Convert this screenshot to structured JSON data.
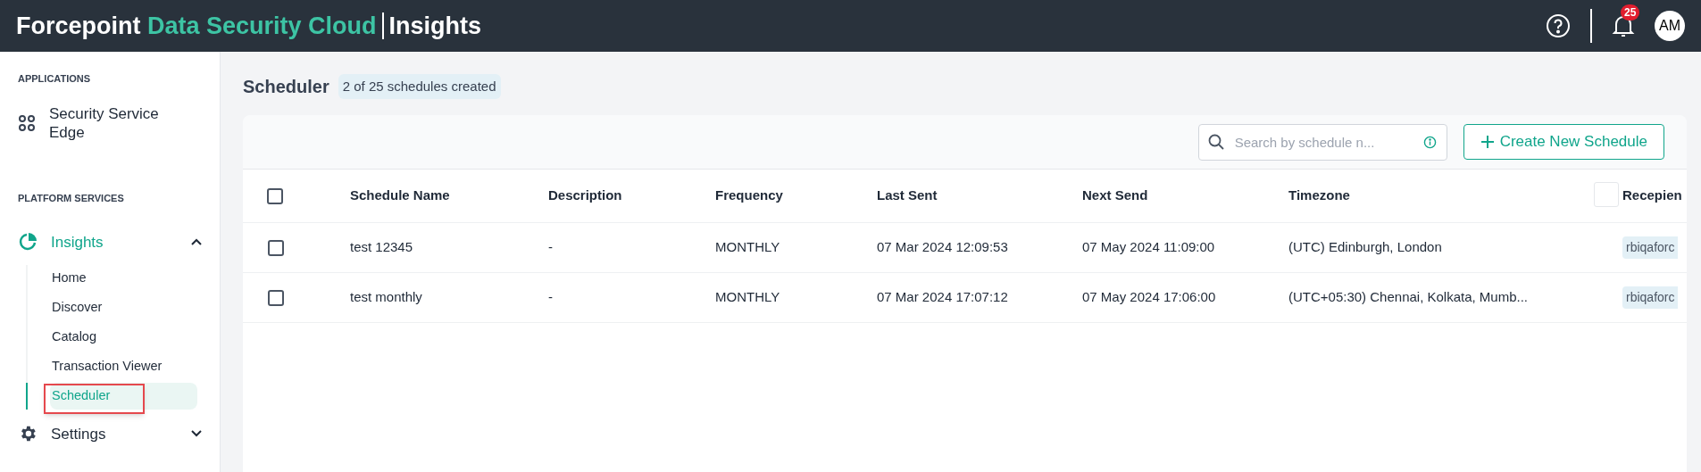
{
  "header": {
    "brand": "Forcepoint",
    "product": "Data Security Cloud",
    "module": "Insights",
    "notification_count": "25",
    "avatar": "AM"
  },
  "sidebar": {
    "sections": [
      {
        "heading": "APPLICATIONS",
        "items": [
          {
            "label": "Security Service Edge",
            "kind": "apps"
          }
        ]
      },
      {
        "heading": "PLATFORM SERVICES",
        "items": [
          {
            "label": "Insights",
            "kind": "chart",
            "expanded": true,
            "children": [
              {
                "label": "Home",
                "selected": false,
                "highlighted": false
              },
              {
                "label": "Discover",
                "selected": false,
                "highlighted": false
              },
              {
                "label": "Catalog",
                "selected": false,
                "highlighted": false
              },
              {
                "label": "Transaction Viewer",
                "selected": false,
                "highlighted": false
              },
              {
                "label": "Scheduler",
                "selected": true,
                "highlighted": true
              }
            ]
          },
          {
            "label": "Settings",
            "kind": "gear",
            "expanded": false
          }
        ]
      }
    ]
  },
  "page": {
    "title": "Scheduler",
    "count_badge": "2 of 25 schedules created"
  },
  "toolbar": {
    "search": {
      "placeholder": "Search by schedule n..."
    },
    "create_button": "Create New Schedule"
  },
  "table": {
    "columns": [
      "Schedule Name",
      "Description",
      "Frequency",
      "Last Sent",
      "Next Send",
      "Timezone",
      "Recepien"
    ],
    "select_all": {
      "checked": false
    },
    "rows": [
      {
        "checked": false,
        "cells": [
          "test 12345",
          "-",
          "MONTHLY",
          "07 Mar 2024 12:09:53",
          "07 May 2024 11:09:00",
          "(UTC) Edinburgh, London"
        ],
        "recipient": "rbiqaforc"
      },
      {
        "checked": false,
        "cells": [
          "test monthly",
          "-",
          "MONTHLY",
          "07 Mar 2024 17:07:12",
          "07 May 2024 17:06:00",
          "(UTC+05:30) Chennai, Kolkata, Mumb..."
        ],
        "recipient": "rbiqaforc"
      }
    ]
  }
}
